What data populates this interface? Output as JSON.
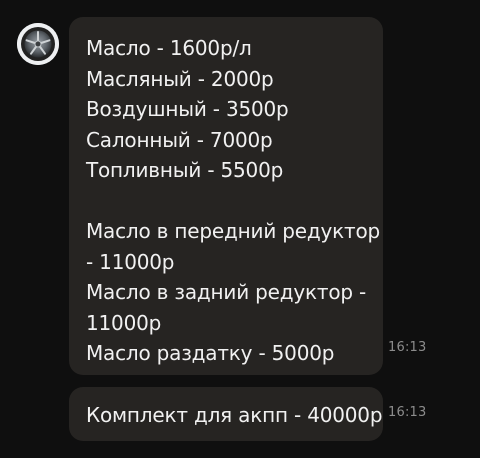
{
  "avatar": {
    "icon": "car-wheel-icon"
  },
  "messages": [
    {
      "lines": [
        "Масло - 1600р/л",
        "Масляный - 2000р",
        "Воздушный - 3500р",
        "Салонный - 7000р",
        "Топливный - 5500р",
        "",
        "Масло в передний редуктор",
        "- 11000р",
        "Масло в задний редуктор -",
        "11000р",
        "Масло раздатку - 5000р"
      ],
      "time": "16:13"
    },
    {
      "lines": [
        "Комплект для акпп - 40000р"
      ],
      "time": "16:13"
    }
  ],
  "colors": {
    "background": "#0f0f0f",
    "bubble": "#262422",
    "text": "#f1f1f1",
    "time": "#8c8c8c"
  }
}
